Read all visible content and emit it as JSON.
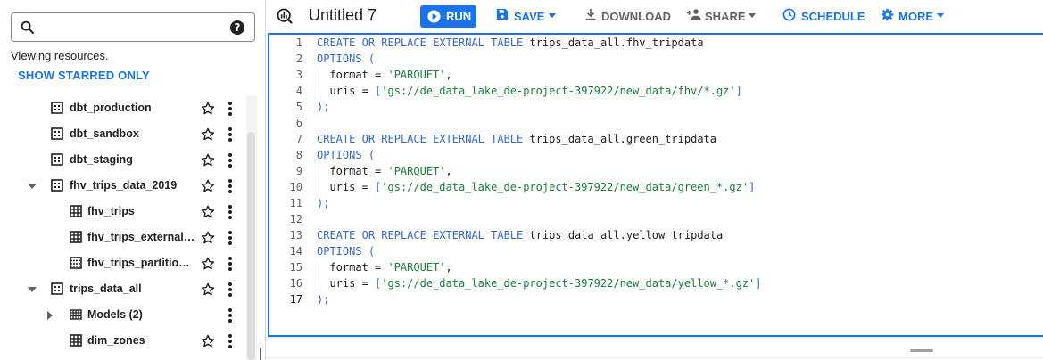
{
  "left_panel": {
    "search": {
      "value": "",
      "placeholder": ""
    },
    "viewing_text": "Viewing resources.",
    "show_starred_label": "SHOW STARRED ONLY",
    "tree": [
      {
        "label": "dbt_production",
        "icon": "dataset-icon",
        "expanded": null,
        "starred": false
      },
      {
        "label": "dbt_sandbox",
        "icon": "dataset-icon",
        "expanded": null,
        "starred": false
      },
      {
        "label": "dbt_staging",
        "icon": "dataset-icon",
        "expanded": null,
        "starred": false
      },
      {
        "label": "fhv_trips_data_2019",
        "icon": "dataset-icon",
        "expanded": true,
        "starred": false
      },
      {
        "label": "fhv_trips",
        "icon": "table-icon",
        "expanded": null,
        "starred": false
      },
      {
        "label": "fhv_trips_external_ta…",
        "icon": "table-icon",
        "expanded": null,
        "starred": false
      },
      {
        "label": "fhv_trips_partitioned",
        "icon": "partitioned-table-icon",
        "expanded": null,
        "starred": false
      },
      {
        "label": "trips_data_all",
        "icon": "dataset-icon",
        "expanded": true,
        "starred": false
      },
      {
        "label": "Models (2)",
        "icon": "models-icon",
        "expanded": false,
        "starred": null
      },
      {
        "label": "dim_zones",
        "icon": "table-icon",
        "expanded": null,
        "starred": false
      }
    ]
  },
  "toolbar": {
    "query_icon": "query-icon",
    "title": "Untitled 7",
    "run_label": "RUN",
    "save_label": "SAVE",
    "download_label": "DOWNLOAD",
    "share_label": "SHARE",
    "schedule_label": "SCHEDULE",
    "more_label": "MORE"
  },
  "editor": {
    "active_line": 17,
    "lines": [
      "CREATE OR REPLACE EXTERNAL TABLE trips_data_all.fhv_tripdata",
      "OPTIONS (",
      "  format = 'PARQUET',",
      "  uris = ['gs://de_data_lake_de-project-397922/new_data/fhv/*.gz']",
      ");",
      "",
      "CREATE OR REPLACE EXTERNAL TABLE trips_data_all.green_tripdata",
      "OPTIONS (",
      "  format = 'PARQUET',",
      "  uris = ['gs://de_data_lake_de-project-397922/new_data/green_*.gz']",
      ");",
      "",
      "CREATE OR REPLACE EXTERNAL TABLE trips_data_all.yellow_tripdata",
      "OPTIONS (",
      "  format = 'PARQUET',",
      "  uris = ['gs://de_data_lake_de-project-397922/new_data/yellow_*.gz']",
      ");"
    ]
  },
  "colors": {
    "accent": "#1a73e8",
    "keyword": "#3367d6",
    "string": "#188038",
    "text": "#202124",
    "muted": "#5f6368"
  }
}
